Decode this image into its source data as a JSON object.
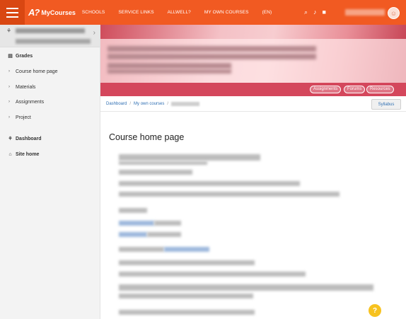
{
  "header": {
    "logo_mark": "A?",
    "logo_name": "MyCourses",
    "nav": [
      "SCHOOLS",
      "SERVICE LINKS",
      "ALLWELL?",
      "MY OWN COURSES",
      "(EN)"
    ],
    "icons": [
      "search-icon",
      "bell-icon",
      "chat-icon"
    ]
  },
  "sidebar": {
    "items": [
      {
        "label": "Grades",
        "icon": "table-icon",
        "type": "top"
      },
      {
        "label": "Course home page",
        "icon": "chevron-right-icon",
        "type": "sub"
      },
      {
        "label": "Materials",
        "icon": "chevron-right-icon",
        "type": "sub"
      },
      {
        "label": "Assignments",
        "icon": "chevron-right-icon",
        "type": "sub"
      },
      {
        "label": "Project",
        "icon": "chevron-right-icon",
        "type": "sub"
      },
      {
        "label": "Dashboard",
        "icon": "dashboard-icon",
        "type": "top"
      },
      {
        "label": "Site home",
        "icon": "home-icon",
        "type": "top"
      }
    ]
  },
  "banner": {
    "buttons": [
      "Assignments",
      "Forums",
      "Resources"
    ]
  },
  "breadcrumb": {
    "items": [
      "Dashboard",
      "My own courses"
    ],
    "syllabus": "Syllabus"
  },
  "main": {
    "title": "Course home page"
  },
  "help": {
    "label": "?"
  },
  "colors": {
    "brand": "#f15a22",
    "link": "#2f6fb3",
    "help": "#f7c21f"
  }
}
